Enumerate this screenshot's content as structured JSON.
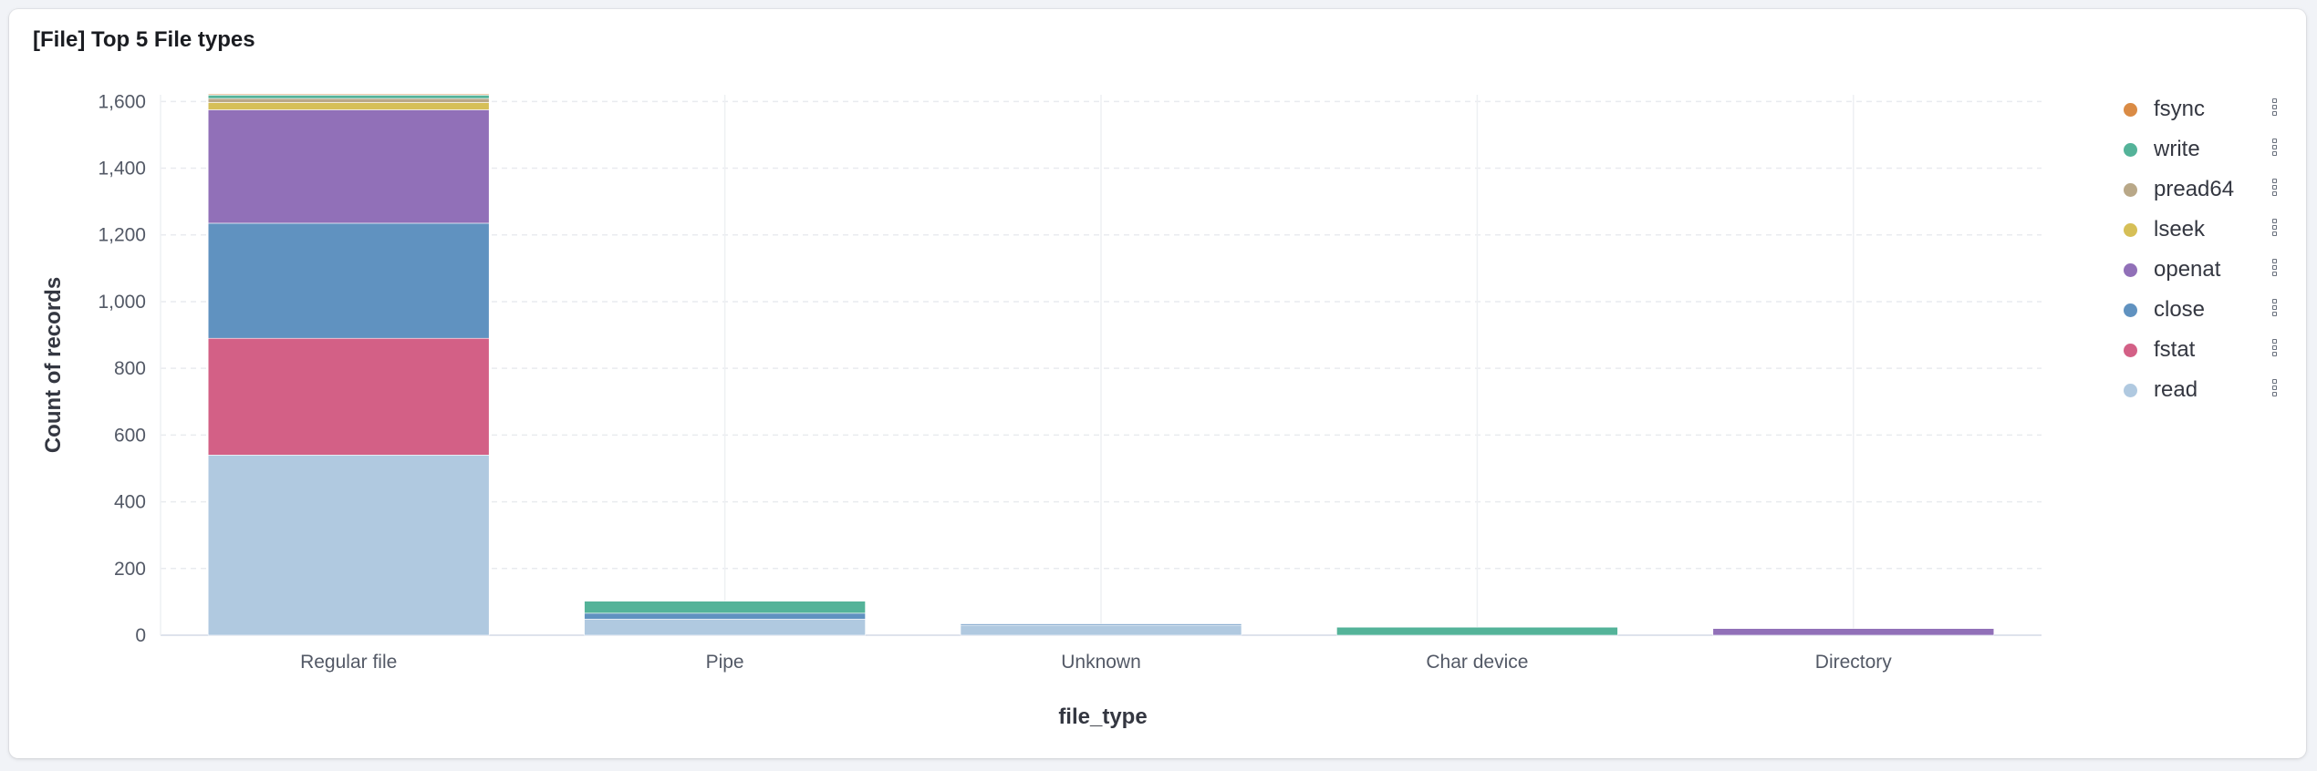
{
  "panel": {
    "title": "[File] Top 5 File types"
  },
  "chart_data": {
    "type": "bar",
    "stacked": true,
    "title": "[File] Top 5 File types",
    "xlabel": "file_type",
    "ylabel": "Count of records",
    "ylim": [
      0,
      1620
    ],
    "yticks": [
      0,
      200,
      400,
      600,
      800,
      1000,
      1200,
      1400,
      1600
    ],
    "ytick_labels": [
      "0",
      "200",
      "400",
      "600",
      "800",
      "1,000",
      "1,200",
      "1,400",
      "1,600"
    ],
    "grid": true,
    "legend_position": "right",
    "categories": [
      "Regular file",
      "Pipe",
      "Unknown",
      "Char device",
      "Directory"
    ],
    "series": [
      {
        "name": "read",
        "color": "#b0c9e0",
        "values": [
          540,
          48,
          30,
          0,
          0
        ]
      },
      {
        "name": "fstat",
        "color": "#d36086",
        "values": [
          350,
          0,
          0,
          0,
          0
        ]
      },
      {
        "name": "close",
        "color": "#6092c0",
        "values": [
          345,
          18,
          4,
          0,
          0
        ]
      },
      {
        "name": "openat",
        "color": "#9170b8",
        "values": [
          340,
          0,
          0,
          0,
          20
        ]
      },
      {
        "name": "lseek",
        "color": "#d6bf57",
        "values": [
          22,
          0,
          0,
          0,
          0
        ]
      },
      {
        "name": "pread64",
        "color": "#b9a888",
        "values": [
          12,
          0,
          0,
          0,
          0
        ]
      },
      {
        "name": "write",
        "color": "#54b399",
        "values": [
          10,
          36,
          0,
          24,
          0
        ]
      },
      {
        "name": "fsync",
        "color": "#da8b45",
        "values": [
          3,
          0,
          0,
          0,
          0
        ]
      }
    ]
  },
  "legend": {
    "items": [
      {
        "label": "fsync",
        "color": "#da8b45"
      },
      {
        "label": "write",
        "color": "#54b399"
      },
      {
        "label": "pread64",
        "color": "#b9a888"
      },
      {
        "label": "lseek",
        "color": "#d6bf57"
      },
      {
        "label": "openat",
        "color": "#9170b8"
      },
      {
        "label": "close",
        "color": "#6092c0"
      },
      {
        "label": "fstat",
        "color": "#d36086"
      },
      {
        "label": "read",
        "color": "#b0c9e0"
      }
    ]
  }
}
